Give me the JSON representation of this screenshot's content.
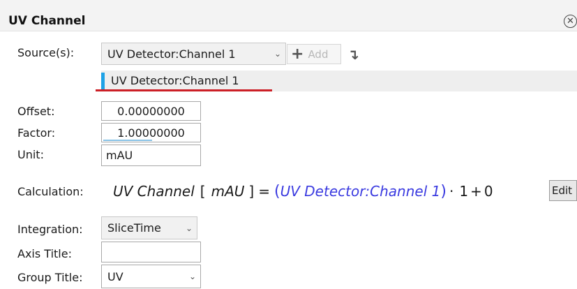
{
  "panel": {
    "title": "UV Channel"
  },
  "source": {
    "label": "Source(s):",
    "selected": "UV Detector:Channel 1",
    "add_label": "Add",
    "list": [
      "UV Detector:Channel 1"
    ]
  },
  "offset": {
    "label": "Offset:",
    "value": "0.00000000"
  },
  "factor": {
    "label": "Factor:",
    "value": "1.00000000"
  },
  "unit": {
    "label": "Unit:",
    "value": "mAU"
  },
  "calculation": {
    "label": "Calculation:",
    "channel": "UV Channel",
    "open_bracket": "[",
    "unit": "mAU",
    "close_bracket": "]",
    "equals": "=",
    "open_paren": "(",
    "source": "UV Detector:Channel 1",
    "close_paren": ")",
    "dot": "·",
    "factor": "1",
    "plus": "+",
    "offset": "0",
    "edit_label": "Edit"
  },
  "integration": {
    "label": "Integration:",
    "value": "SliceTime"
  },
  "axis_title": {
    "label": "Axis Title:",
    "value": ""
  },
  "group_title": {
    "label": "Group Title:",
    "value": "UV"
  },
  "icons": {
    "close": "close-circle-icon",
    "add": "plus-icon",
    "move_down": "arrow-down-right-icon",
    "dropdown": "chevron-down-icon"
  },
  "colors": {
    "accent": "#1ea2e6",
    "underline": "#cc1f26",
    "formula_link": "#3a3ae0"
  }
}
